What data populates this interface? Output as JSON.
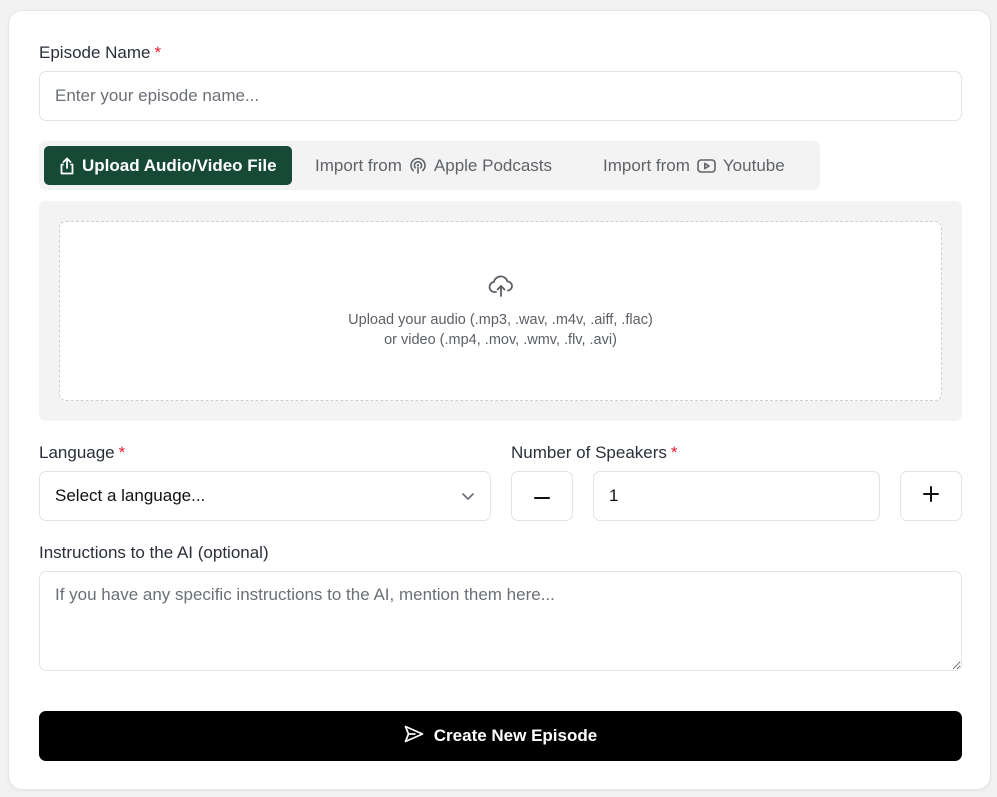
{
  "episode": {
    "label": "Episode Name",
    "required_mark": "*",
    "placeholder": "Enter your episode name..."
  },
  "source_tabs": {
    "upload_label": "Upload Audio/Video File",
    "apple_prefix": "Import from",
    "apple_label": "Apple Podcasts",
    "youtube_prefix": "Import from",
    "youtube_label": "Youtube",
    "active": "upload"
  },
  "upload": {
    "line1": "Upload your audio (.mp3, .wav, .m4v, .aiff, .flac)",
    "line2": "or video (.mp4, .mov, .wmv, .flv, .avi)"
  },
  "language": {
    "label": "Language",
    "required_mark": "*",
    "value": "Select a language..."
  },
  "speakers": {
    "label": "Number of Speakers",
    "required_mark": "*",
    "value": "1"
  },
  "instructions": {
    "label": "Instructions to the AI (optional)",
    "placeholder": "If you have any specific instructions to the AI, mention them here..."
  },
  "create_button": {
    "label": "Create New Episode"
  },
  "colors": {
    "accent": "#164a36",
    "required": "#e11d2e",
    "primary_button": "#000000"
  },
  "icons": {
    "upload_tab": "share-upload-icon",
    "apple": "podcast-icon",
    "youtube": "youtube-icon",
    "dropzone": "cloud-upload-icon",
    "select": "chevron-down-icon",
    "minus": "minus-icon",
    "plus": "plus-icon",
    "send": "send-icon"
  }
}
